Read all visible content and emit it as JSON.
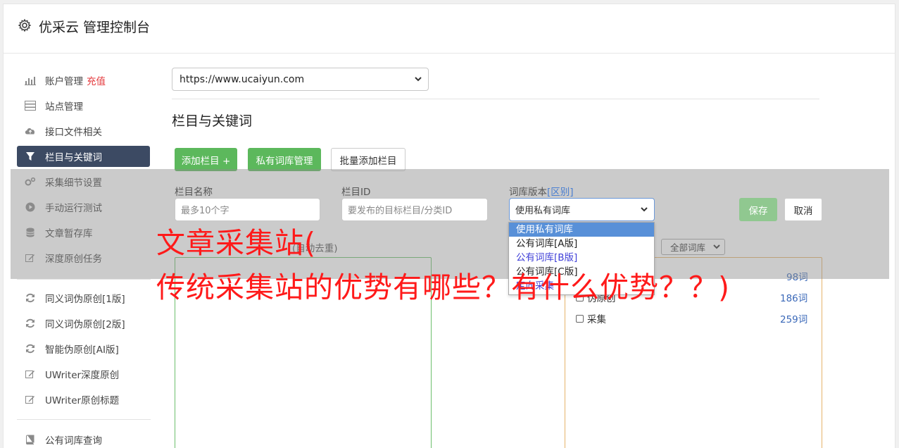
{
  "header": {
    "title": "优采云 管理控制台",
    "icon": "gear-icon"
  },
  "sidebar": {
    "items": [
      {
        "label": "账户管理",
        "badge": "充值",
        "icon": "bar-chart-icon"
      },
      {
        "label": "站点管理",
        "icon": "server-icon"
      },
      {
        "label": "接口文件相关",
        "icon": "cloud-upload-icon"
      },
      {
        "label": "栏目与关键词",
        "icon": "filter-icon",
        "active": true
      },
      {
        "label": "采集细节设置",
        "icon": "cogs-icon"
      },
      {
        "label": "手动运行测试",
        "icon": "play-circle-icon"
      },
      {
        "label": "文章暂存库",
        "icon": "database-icon"
      },
      {
        "label": "深度原创任务",
        "icon": "edit-icon"
      },
      {
        "label": "同义词伪原创[1版]",
        "icon": "refresh-icon"
      },
      {
        "label": "同义词伪原创[2版]",
        "icon": "refresh-icon"
      },
      {
        "label": "智能伪原创[AI版]",
        "icon": "refresh-icon"
      },
      {
        "label": "UWriter深度原创",
        "icon": "edit-icon"
      },
      {
        "label": "UWriter原创标题",
        "icon": "edit-icon"
      },
      {
        "label": "公有词库查询",
        "icon": "book-icon"
      }
    ]
  },
  "main": {
    "site_select": "https://www.ucaiyun.com",
    "section_title": "栏目与关键词",
    "buttons": {
      "add_column": "添加栏目 +",
      "private_lib": "私有词库管理",
      "batch_add": "批量添加栏目"
    },
    "form": {
      "name_label": "栏目名称",
      "name_placeholder": "最多10个字",
      "id_label": "栏目ID",
      "id_placeholder": "要发布的目标栏目/分类ID",
      "lib_label": "词库版本",
      "lib_label_link": "[区别]",
      "lib_value": "使用私有词库",
      "save": "保存",
      "cancel": "取消"
    },
    "dropdown_options": [
      "使用私有词库",
      "公有词库[A版]",
      "公有词库[B版]",
      "公有词库[C版]",
      "定向采集"
    ],
    "keywords_label_partial": "(自动去重)",
    "lib_filter": "全部词库",
    "keyword_rows": [
      {
        "label": "",
        "count": "98词"
      },
      {
        "label": "伪原创",
        "count": "186词"
      },
      {
        "label": "采集",
        "count": "259词"
      }
    ]
  },
  "overlay": {
    "line1": "文章采集站(",
    "line2": "传统采集站的优势有哪些？有什么优势？？)"
  },
  "colors": {
    "accent_green": "#5cb85c",
    "nav_active": "#3c4a63",
    "overlay_text": "#ff1a1a"
  }
}
